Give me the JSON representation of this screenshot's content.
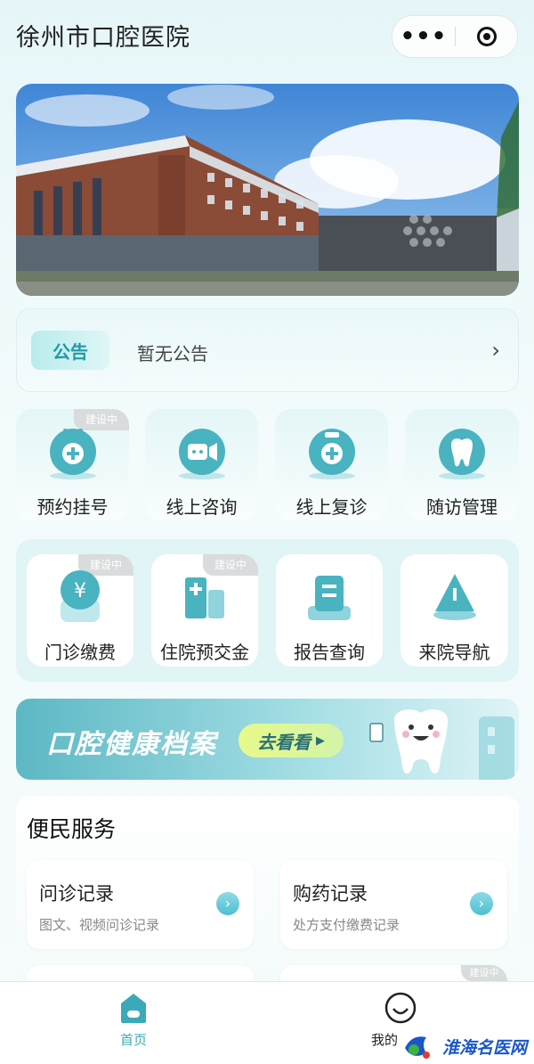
{
  "header": {
    "title": "徐州市口腔医院",
    "more_label": "•••"
  },
  "notice": {
    "tag": "公告",
    "text": "暂无公告",
    "chevron": "›"
  },
  "services_row1": [
    {
      "label": "预约挂号",
      "badge": "建设中",
      "icon": "baby-bottle-plus-icon"
    },
    {
      "label": "线上咨询",
      "badge": "",
      "icon": "video-chat-icon"
    },
    {
      "label": "线上复诊",
      "badge": "",
      "icon": "medicine-bottle-plus-icon"
    },
    {
      "label": "随访管理",
      "badge": "",
      "icon": "tooth-icon"
    }
  ],
  "services_row2": [
    {
      "label": "门诊缴费",
      "badge": "建设中",
      "icon": "yuan-coin-icon"
    },
    {
      "label": "住院预交金",
      "badge": "建设中",
      "icon": "hospital-building-icon"
    },
    {
      "label": "报告查询",
      "badge": "",
      "icon": "report-document-icon"
    },
    {
      "label": "来院导航",
      "badge": "",
      "icon": "navigation-cone-icon"
    }
  ],
  "health": {
    "title": "口腔健康档案",
    "button": "去看看"
  },
  "convenience": {
    "title": "便民服务",
    "items": [
      {
        "name": "问诊记录",
        "desc": "图文、视频问诊记录"
      },
      {
        "name": "购药记录",
        "desc": "处方支付缴费记录"
      }
    ],
    "peek_badge": "建设中"
  },
  "tabbar": {
    "tabs": [
      {
        "label": "首页",
        "active": true,
        "color": "#3aaab8"
      },
      {
        "label": "我的",
        "active": false,
        "color": "#333333"
      }
    ]
  },
  "watermark": {
    "text": "淮海名医网"
  },
  "colors": {
    "accent": "#3aaab8",
    "icon_teal": "#49b3c0"
  }
}
